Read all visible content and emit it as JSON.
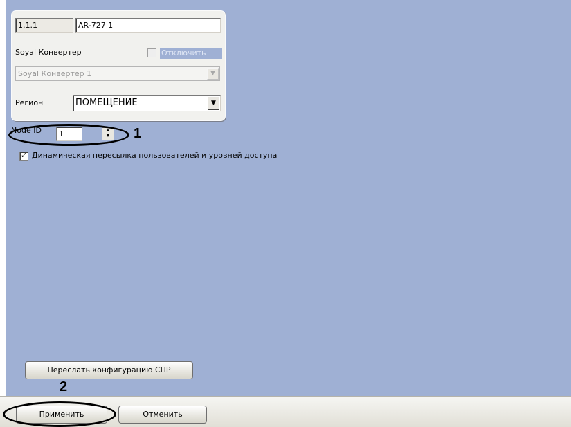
{
  "settings": {
    "address": "1.1.1",
    "name": "AR-727 1",
    "converter_label": "Soyal Конвертер",
    "disable_label": "Отключить",
    "converter_value": "Soyal Конвертер 1",
    "region_label": "Регион",
    "region_value": "ПОМЕЩЕНИЕ",
    "node_id_label": "Node ID",
    "node_id_value": "1",
    "dynamic_label": "Динамическая пересылка пользователей и уровней доступа",
    "dynamic_checked": true,
    "send_config_label": "Переслать конфигурацию СПР"
  },
  "footer": {
    "apply_label": "Применить",
    "cancel_label": "Отменить"
  },
  "annotations": {
    "marker_1": "1",
    "marker_2": "2"
  },
  "icons": {
    "combo": "chevron-down-icon",
    "spin": "spin-arrows-icon",
    "check": "checkmark-icon"
  },
  "colors": {
    "panel_bg": "#9fb0d4",
    "group_bg": "#f1f1ee",
    "annotation": "#000000"
  }
}
